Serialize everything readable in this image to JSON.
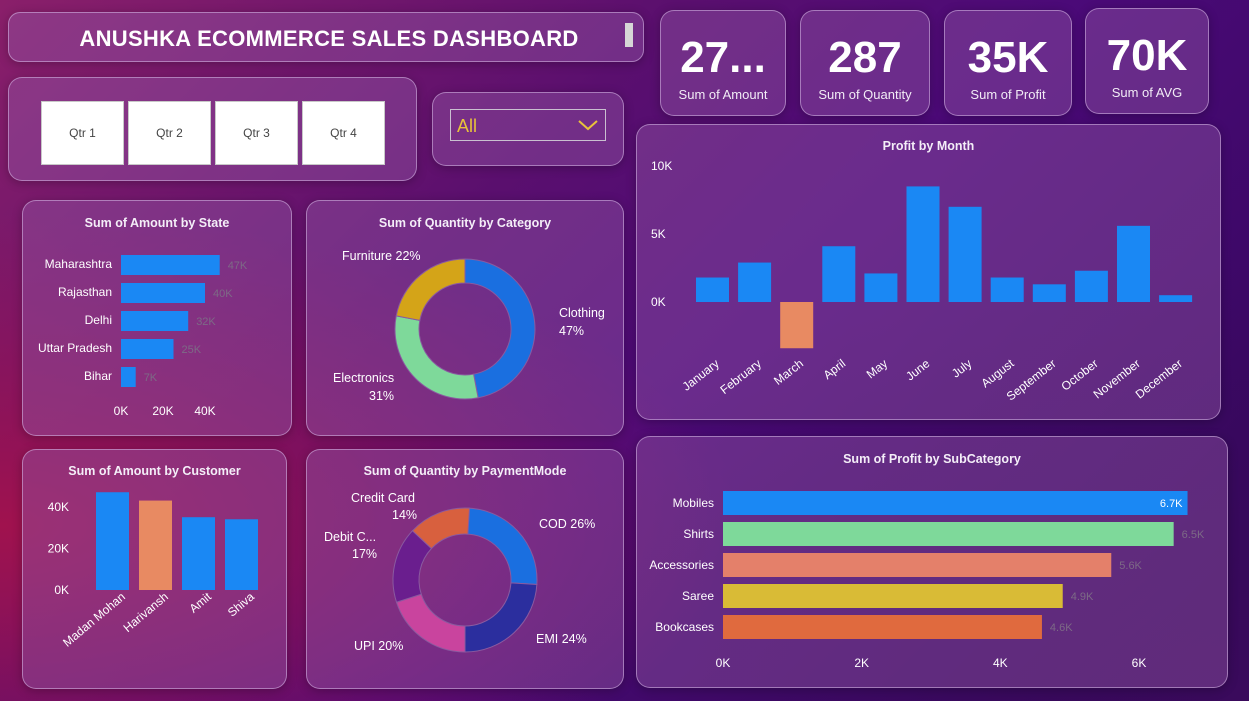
{
  "title": "ANUSHKA ECOMMERCE SALES DASHBOARD",
  "kpis": [
    {
      "value": "27...",
      "label": "Sum of Amount"
    },
    {
      "value": "287",
      "label": "Sum of Quantity"
    },
    {
      "value": "35K",
      "label": "Sum of Profit"
    },
    {
      "value": "70K",
      "label": "Sum of AVG"
    }
  ],
  "quarter_slicer": [
    "Qtr 1",
    "Qtr 2",
    "Qtr 3",
    "Qtr 4"
  ],
  "dropdown": {
    "selected": "All"
  },
  "colors": {
    "blue": "#1a88f4",
    "orange": "#e88a62",
    "green": "#7ed99a",
    "gold": "#d4a418",
    "yellow": "#d9bb36",
    "orange2": "#e4713f",
    "navy": "#2b2e9e",
    "violet": "#6a1e8e",
    "pink": "#c9449e",
    "red": "#d8603e"
  },
  "charts": {
    "state": {
      "title": "Sum of Amount by State",
      "chart_data": {
        "type": "bar",
        "orientation": "horizontal",
        "categories": [
          "Maharashtra",
          "Rajasthan",
          "Delhi",
          "Uttar Pradesh",
          "Bihar"
        ],
        "values": [
          47000,
          40000,
          32000,
          25000,
          7000
        ],
        "data_labels": [
          "47K",
          "40K",
          "32K",
          "25K",
          "7K"
        ],
        "x_ticks": [
          "0K",
          "20K",
          "40K"
        ],
        "xlim": [
          0,
          50000
        ]
      }
    },
    "category": {
      "title": "Sum of Quantity by Category",
      "chart_data": {
        "type": "pie",
        "donut": true,
        "slices": [
          {
            "label": "Clothing",
            "pct": 47,
            "color": "#1a6fe0",
            "text": "Clothing",
            "pct_text": "47%"
          },
          {
            "label": "Electronics",
            "pct": 31,
            "color": "#7ed99a",
            "text": "Electronics",
            "pct_text": "31%"
          },
          {
            "label": "Furniture",
            "pct": 22,
            "color": "#d4a418",
            "text": "Furniture 22%",
            "pct_text": ""
          }
        ]
      }
    },
    "customer": {
      "title": "Sum of Amount by Customer",
      "chart_data": {
        "type": "bar",
        "categories": [
          "Madan Mohan",
          "Harivansh",
          "Amit",
          "Shiva"
        ],
        "values": [
          47000,
          43000,
          35000,
          34000
        ],
        "colors": [
          "#1a88f4",
          "#e88a62",
          "#1a88f4",
          "#1a88f4"
        ],
        "y_ticks": [
          "0K",
          "20K",
          "40K"
        ],
        "ylim": [
          0,
          50000
        ]
      }
    },
    "payment": {
      "title": "Sum of Quantity by PaymentMode",
      "chart_data": {
        "type": "pie",
        "donut": true,
        "slices": [
          {
            "label": "COD",
            "pct": 26,
            "color": "#1a6fe0",
            "text": "COD 26%"
          },
          {
            "label": "EMI",
            "pct": 24,
            "color": "#2b2e9e",
            "text": "EMI 24%"
          },
          {
            "label": "UPI",
            "pct": 20,
            "color": "#c9449e",
            "text": "UPI 20%"
          },
          {
            "label": "Debit C...",
            "pct": 17,
            "color": "#6a1e8e",
            "text": "Debit C...",
            "pct_text": "17%"
          },
          {
            "label": "Credit Card",
            "pct": 14,
            "color": "#d8603e",
            "text": "Credit Card",
            "pct_text": "14%"
          }
        ]
      }
    },
    "month": {
      "title": "Profit by Month",
      "chart_data": {
        "type": "bar",
        "categories": [
          "January",
          "February",
          "March",
          "April",
          "May",
          "June",
          "July",
          "August",
          "September",
          "October",
          "November",
          "December"
        ],
        "values": [
          1800,
          2900,
          -3400,
          4100,
          2100,
          8500,
          7000,
          1800,
          1300,
          2300,
          5600,
          500
        ],
        "colors": [
          "#1a88f4",
          "#1a88f4",
          "#e88a62",
          "#1a88f4",
          "#1a88f4",
          "#1a88f4",
          "#1a88f4",
          "#1a88f4",
          "#1a88f4",
          "#1a88f4",
          "#1a88f4",
          "#1a88f4"
        ],
        "y_ticks": [
          "0K",
          "5K",
          "10K"
        ],
        "ylim": [
          -4000,
          10000
        ]
      }
    },
    "subcategory": {
      "title": "Sum of Profit by SubCategory",
      "chart_data": {
        "type": "bar",
        "orientation": "horizontal",
        "categories": [
          "Mobiles",
          "Shirts",
          "Accessories",
          "Saree",
          "Bookcases"
        ],
        "values": [
          6700,
          6500,
          5600,
          4900,
          4600
        ],
        "data_labels": [
          "6.7K",
          "6.5K",
          "5.6K",
          "4.9K",
          "4.6K"
        ],
        "colors": [
          "#1a88f4",
          "#7ed99a",
          "#e4806a",
          "#d9bb36",
          "#e06a3e"
        ],
        "x_ticks": [
          "0K",
          "2K",
          "4K",
          "6K"
        ],
        "xlim": [
          0,
          7000
        ]
      }
    }
  }
}
